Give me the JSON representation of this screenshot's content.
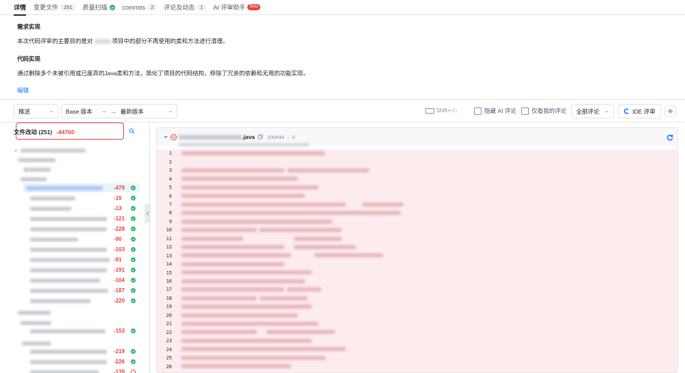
{
  "tabs": [
    {
      "label": "详情",
      "active": true
    },
    {
      "label": "变更文件",
      "count": "251"
    },
    {
      "label": "质量扫描",
      "status": "ok"
    },
    {
      "label": "commits",
      "count": "2"
    },
    {
      "label": "评论及动态",
      "count": "1"
    },
    {
      "label": "AI 评审助手",
      "badge": "Beta"
    }
  ],
  "description": {
    "requirement_title": "需求实现",
    "requirement_text_before": "本次代码评审的主要目的是对",
    "requirement_text_after": "项目中的部分不再使用的类和方法进行清理。",
    "code_title": "代码实现",
    "code_text": "通过删除多个未被引用或已废弃的Java类和方法，简化了项目的代码结构，移除了冗余的依赖和无用的功能实现。",
    "edit_label": "编辑"
  },
  "toolbar": {
    "push_select": "推送",
    "base_select": "Base 版本",
    "arrow": "→",
    "target_select": "最新版本",
    "shortcut": "Shift+↑/↓",
    "hide_ai_label": "隐藏 AI 评论",
    "only_mine_label": "仅看我的评论",
    "comment_filter": "全部评论",
    "ide_button": "IDE 评审"
  },
  "files": {
    "header": "文件改动 (251)",
    "total": "-44760",
    "rows": [
      {
        "count": "-479"
      },
      {
        "count": "-16"
      },
      {
        "count": "-13"
      },
      {
        "count": "-121"
      },
      {
        "count": "-228"
      },
      {
        "count": "-90"
      },
      {
        "count": "-103"
      },
      {
        "count": "-91"
      },
      {
        "count": "-191"
      },
      {
        "count": "-104"
      },
      {
        "count": "-187"
      },
      {
        "count": "-220"
      },
      {
        "count": "-153"
      },
      {
        "count": "-219"
      },
      {
        "count": "-226"
      },
      {
        "count": "-139"
      }
    ]
  },
  "diff": {
    "file_ext": ".java",
    "mode_change": "100644 → 0",
    "line_numbers": [
      "1",
      "2",
      "3",
      "4",
      "5",
      "6",
      "7",
      "8",
      "9",
      "10",
      "11",
      "12",
      "13",
      "14",
      "15",
      "16",
      "17",
      "18",
      "19",
      "20",
      "21",
      "22",
      "23",
      "24",
      "25",
      "26"
    ]
  },
  "colors": {
    "accent": "#1677ff",
    "deletion": "#e8413c",
    "added_ok": "#2fb567",
    "diff_bg": "#fdecee"
  }
}
